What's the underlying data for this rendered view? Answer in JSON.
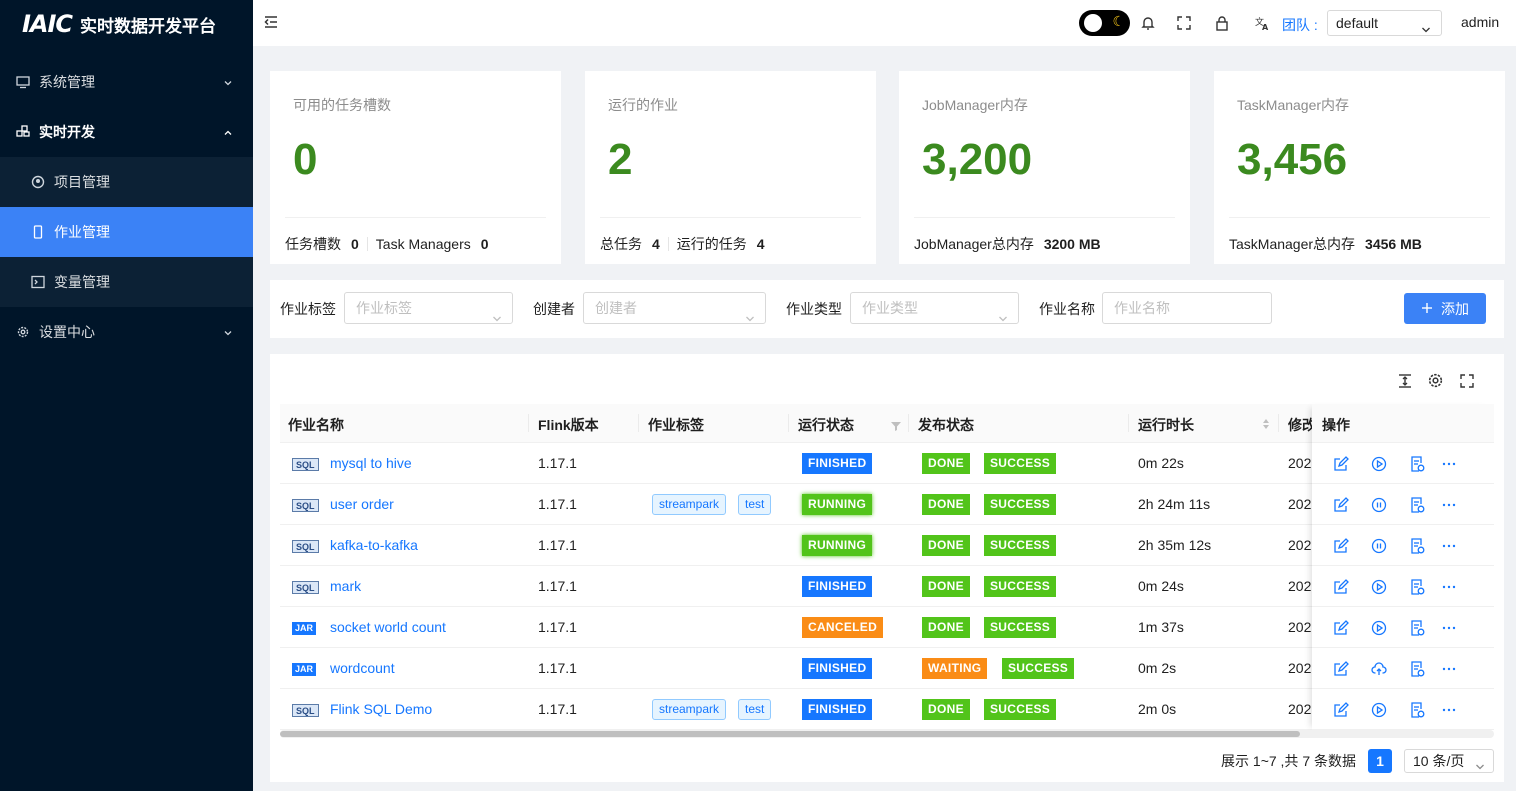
{
  "app": {
    "logo_mark": "IAIC",
    "title": "实时数据开发平台"
  },
  "sidebar": {
    "items": [
      {
        "label": "系统管理"
      },
      {
        "label": "实时开发"
      },
      {
        "label": "项目管理"
      },
      {
        "label": "作业管理"
      },
      {
        "label": "变量管理"
      },
      {
        "label": "设置中心"
      }
    ]
  },
  "header": {
    "team_label": "团队 :",
    "team_value": "default",
    "user": "admin"
  },
  "cards": [
    {
      "title": "可用的任务槽数",
      "value": "0",
      "foot": [
        {
          "label": "任务槽数",
          "value": "0"
        },
        {
          "label": "Task Managers",
          "value": "0"
        }
      ]
    },
    {
      "title": "运行的作业",
      "value": "2",
      "foot": [
        {
          "label": "总任务",
          "value": "4"
        },
        {
          "label": "运行的任务",
          "value": "4"
        }
      ]
    },
    {
      "title": "JobManager内存",
      "value": "3,200",
      "foot": [
        {
          "label": "JobManager总内存",
          "value": "3200 MB"
        }
      ]
    },
    {
      "title": "TaskManager内存",
      "value": "3,456",
      "foot": [
        {
          "label": "TaskManager总内存",
          "value": "3456 MB"
        }
      ]
    }
  ],
  "search": {
    "tag_label": "作业标签",
    "tag_placeholder": "作业标签",
    "creator_label": "创建者",
    "creator_placeholder": "创建者",
    "type_label": "作业类型",
    "type_placeholder": "作业类型",
    "name_label": "作业名称",
    "name_placeholder": "作业名称",
    "add_button": "添加"
  },
  "table": {
    "columns": [
      "作业名称",
      "Flink版本",
      "作业标签",
      "运行状态",
      "发布状态",
      "运行时长",
      "修改",
      "操作"
    ],
    "rows": [
      {
        "type": "SQL",
        "name": "mysql to hive",
        "version": "1.17.1",
        "tags": [],
        "status": "FINISHED",
        "release": "DONE",
        "build": "SUCCESS",
        "duration": "0m 22s",
        "modified": "202"
      },
      {
        "type": "SQL",
        "name": "user order",
        "version": "1.17.1",
        "tags": [
          "streampark",
          "test"
        ],
        "status": "RUNNING",
        "release": "DONE",
        "build": "SUCCESS",
        "duration": "2h 24m 11s",
        "modified": "202"
      },
      {
        "type": "SQL",
        "name": "kafka-to-kafka",
        "version": "1.17.1",
        "tags": [],
        "status": "RUNNING",
        "release": "DONE",
        "build": "SUCCESS",
        "duration": "2h 35m 12s",
        "modified": "202"
      },
      {
        "type": "SQL",
        "name": "mark",
        "version": "1.17.1",
        "tags": [],
        "status": "FINISHED",
        "release": "DONE",
        "build": "SUCCESS",
        "duration": "0m 24s",
        "modified": "202"
      },
      {
        "type": "JAR",
        "name": "socket world count",
        "version": "1.17.1",
        "tags": [],
        "status": "CANCELED",
        "release": "DONE",
        "build": "SUCCESS",
        "duration": "1m 37s",
        "modified": "202"
      },
      {
        "type": "JAR",
        "name": "wordcount",
        "version": "1.17.1",
        "tags": [],
        "status": "FINISHED",
        "release": "WAITING",
        "build": "SUCCESS",
        "duration": "0m 2s",
        "modified": "202"
      },
      {
        "type": "SQL",
        "name": "Flink SQL Demo",
        "version": "1.17.1",
        "tags": [
          "streampark",
          "test"
        ],
        "status": "FINISHED",
        "release": "DONE",
        "build": "SUCCESS",
        "duration": "2m 0s",
        "modified": "202"
      }
    ]
  },
  "pagination": {
    "summary": "展示 1~7 ,共 7 条数据",
    "current": "1",
    "page_size": "10 条/页"
  }
}
